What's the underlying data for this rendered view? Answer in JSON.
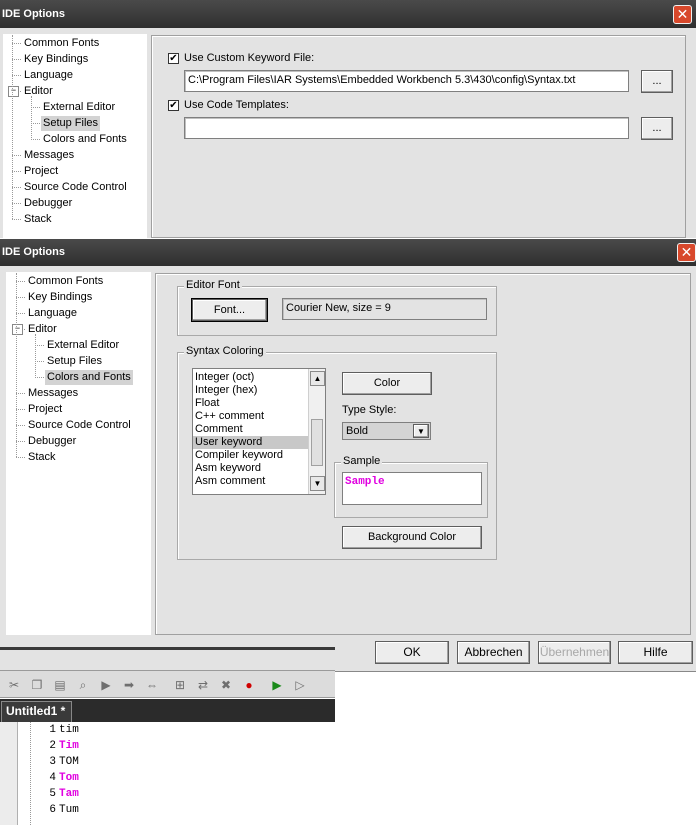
{
  "window1": {
    "title": "IDE Options",
    "close_glyph": "✕",
    "tree": [
      {
        "label": "Common Fonts",
        "level": 0
      },
      {
        "label": "Key Bindings",
        "level": 0
      },
      {
        "label": "Language",
        "level": 0
      },
      {
        "label": "Editor",
        "level": 0,
        "expander": "−"
      },
      {
        "label": "External Editor",
        "level": 1
      },
      {
        "label": "Setup Files",
        "level": 1,
        "selected": true
      },
      {
        "label": "Colors and Fonts",
        "level": 1
      },
      {
        "label": "Messages",
        "level": 0
      },
      {
        "label": "Project",
        "level": 0
      },
      {
        "label": "Source Code Control",
        "level": 0
      },
      {
        "label": "Debugger",
        "level": 0
      },
      {
        "label": "Stack",
        "level": 0
      }
    ],
    "use_keyword_file": {
      "label": "Use Custom Keyword File:",
      "checked": true,
      "check_glyph": "✔",
      "path": "C:\\Program Files\\IAR Systems\\Embedded Workbench 5.3\\430\\config\\Syntax.txt",
      "browse_label": "..."
    },
    "use_code_templates": {
      "label": "Use Code Templates:",
      "checked": true,
      "check_glyph": "✔",
      "path": "",
      "browse_label": "..."
    }
  },
  "window2": {
    "title": "IDE Options",
    "close_glyph": "✕",
    "tree": [
      {
        "label": "Common Fonts",
        "level": 0
      },
      {
        "label": "Key Bindings",
        "level": 0
      },
      {
        "label": "Language",
        "level": 0
      },
      {
        "label": "Editor",
        "level": 0,
        "expander": "−"
      },
      {
        "label": "External Editor",
        "level": 1
      },
      {
        "label": "Setup Files",
        "level": 1
      },
      {
        "label": "Colors and Fonts",
        "level": 1,
        "selected": true
      },
      {
        "label": "Messages",
        "level": 0
      },
      {
        "label": "Project",
        "level": 0
      },
      {
        "label": "Source Code Control",
        "level": 0
      },
      {
        "label": "Debugger",
        "level": 0
      },
      {
        "label": "Stack",
        "level": 0
      }
    ],
    "editor_font": {
      "group_label": "Editor Font",
      "button_label": "Font...",
      "font_desc": "Courier New, size = 9"
    },
    "syntax_coloring": {
      "group_label": "Syntax Coloring",
      "items": [
        {
          "label": "Integer (oct)"
        },
        {
          "label": "Integer (hex)"
        },
        {
          "label": "Float"
        },
        {
          "label": "C++ comment"
        },
        {
          "label": "Comment"
        },
        {
          "label": "User keyword",
          "selected": true
        },
        {
          "label": "Compiler keyword"
        },
        {
          "label": "Asm keyword"
        },
        {
          "label": "Asm comment"
        }
      ],
      "scroll_up_glyph": "▲",
      "scroll_down_glyph": "▼",
      "color_button_label": "Color",
      "type_style_label": "Type Style:",
      "type_style_value": "Bold",
      "dropdown_glyph": "▼",
      "sample_group_label": "Sample",
      "sample_text": "Sample",
      "sample_color": "#e000e0",
      "background_color_button_label": "Background Color"
    },
    "footer_buttons": [
      {
        "label": "OK",
        "enabled": true
      },
      {
        "label": "Abbrechen",
        "enabled": true
      },
      {
        "label": "Übernehmen",
        "enabled": false
      },
      {
        "label": "Hilfe",
        "enabled": true
      }
    ]
  },
  "editor": {
    "toolbar_icons": [
      "cut-icon",
      "copy-icon",
      "paste-icon",
      "find-icon",
      "bookmark-icon",
      "next-bookmark-icon",
      "prev-bookmark-icon",
      "toggle-breakpoint-icon",
      "step-icon",
      "run-icon",
      "stop-icon",
      "debug-icon",
      "make-icon"
    ],
    "tab_label": "Untitled1 *",
    "keyword_color": "#e000e0",
    "lines": [
      {
        "num": "1",
        "text": "tim",
        "keyword": false
      },
      {
        "num": "2",
        "text": "Tim",
        "keyword": true
      },
      {
        "num": "3",
        "text": "TOM",
        "keyword": false
      },
      {
        "num": "4",
        "text": "Tom",
        "keyword": true
      },
      {
        "num": "5",
        "text": "Tam",
        "keyword": true
      },
      {
        "num": "6",
        "text": "Tum",
        "keyword": false
      }
    ]
  }
}
